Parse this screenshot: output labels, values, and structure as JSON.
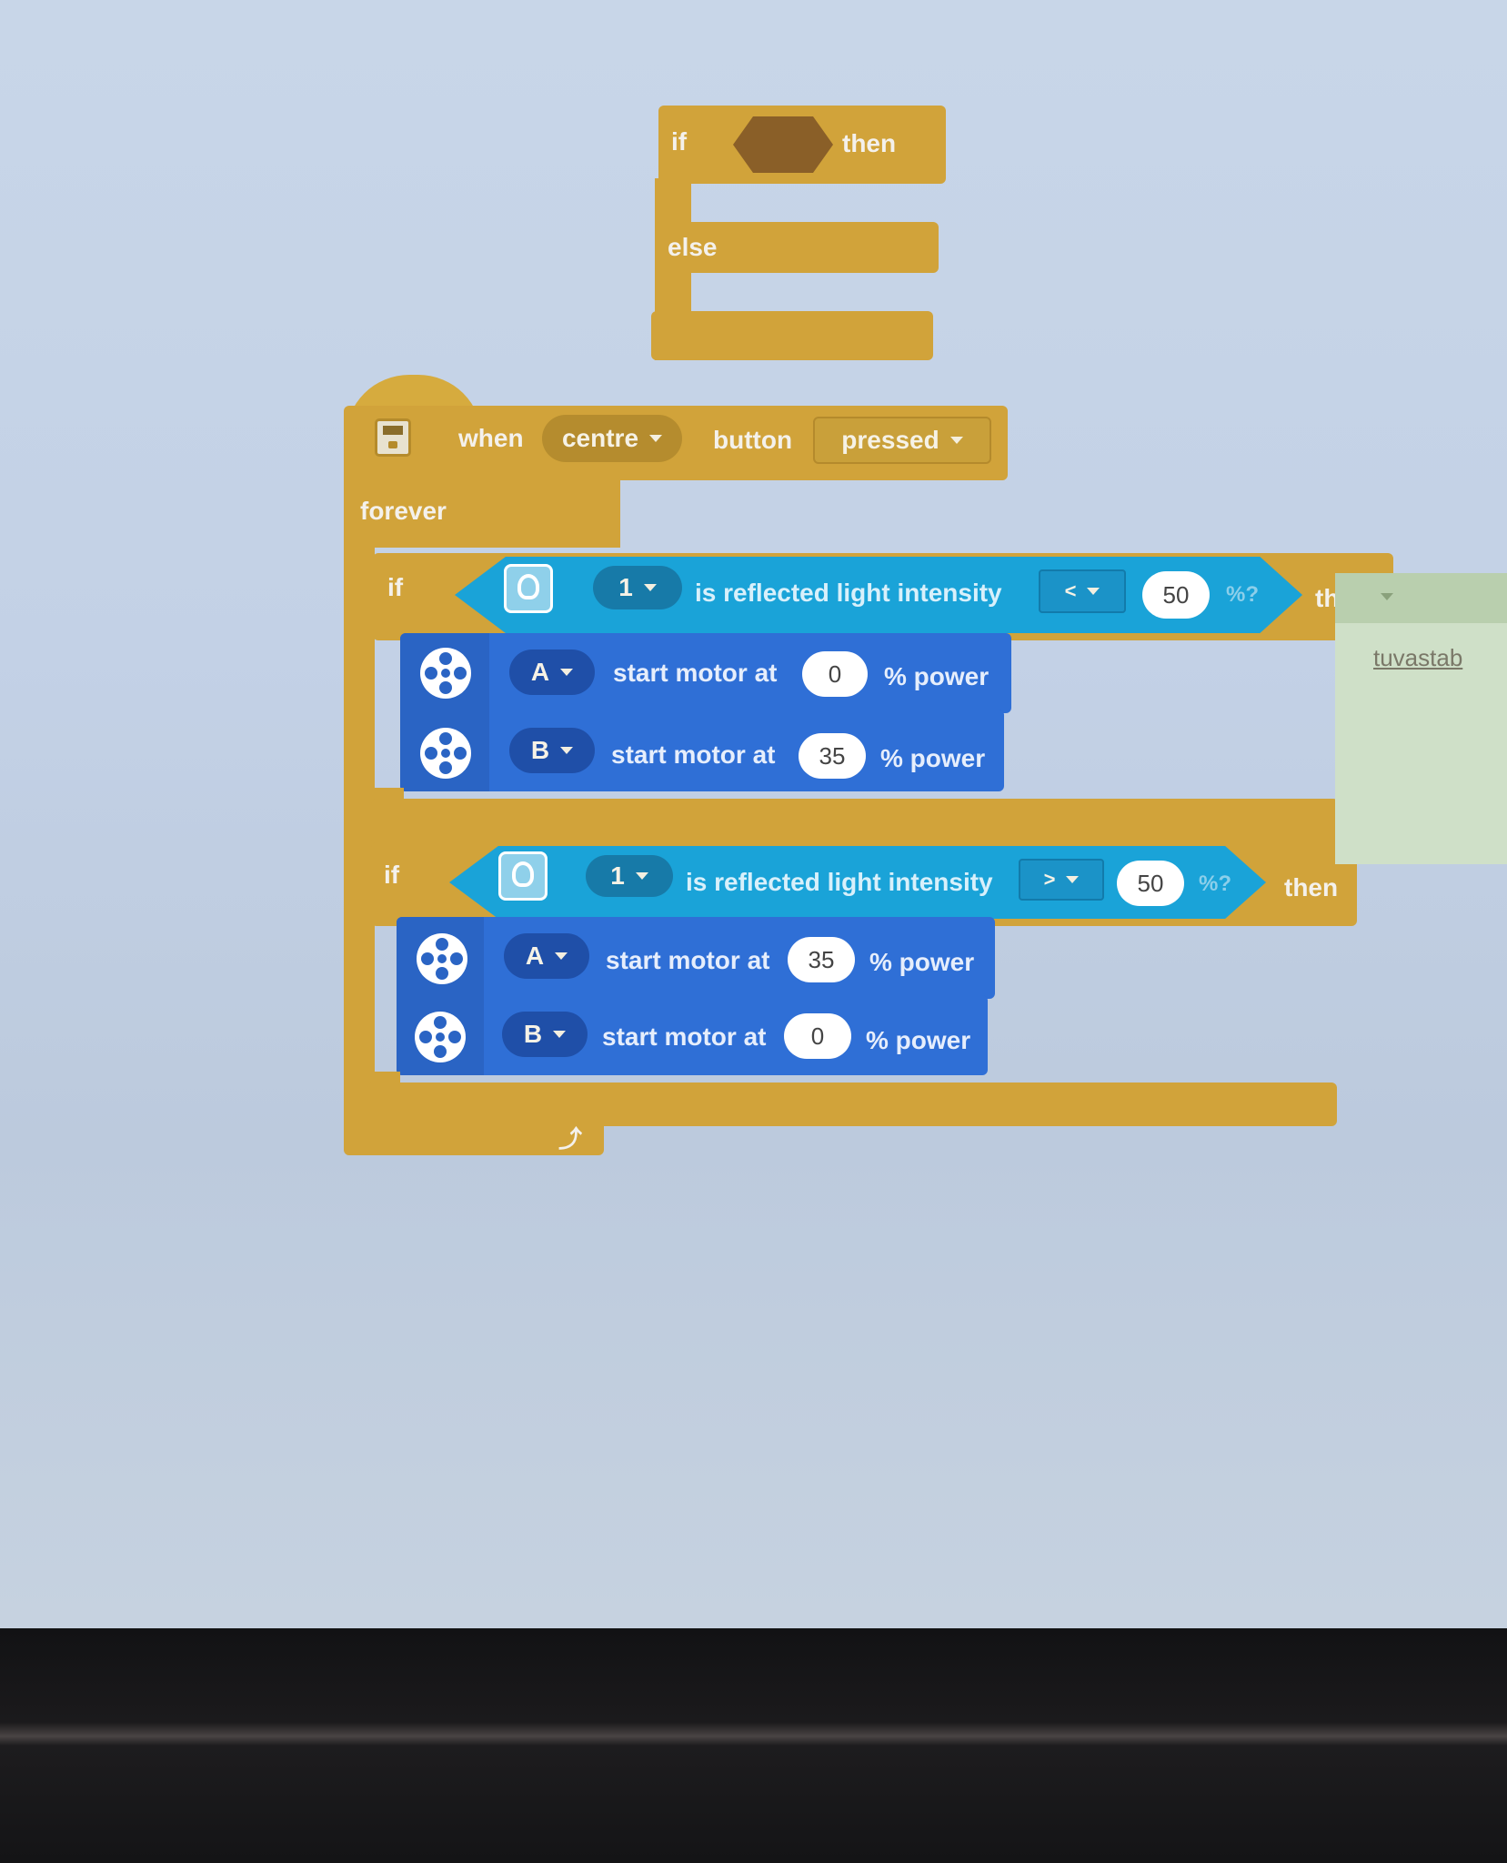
{
  "top_if_block": {
    "if_label": "if",
    "then_label": "then",
    "else_label": "else"
  },
  "hat_block": {
    "when_label": "when",
    "button_dropdown": "centre",
    "button_label": "button",
    "state_dropdown": "pressed"
  },
  "forever_label": "forever",
  "if1": {
    "if_label": "if",
    "port": "1",
    "condition_text": "is reflected light intensity",
    "operator": "<",
    "value": "50",
    "unit": "%?",
    "then_label": "the",
    "motors": [
      {
        "port": "A",
        "text": "start motor at",
        "value": "0",
        "unit": "% power"
      },
      {
        "port": "B",
        "text": "start motor at",
        "value": "35",
        "unit": "% power"
      }
    ]
  },
  "if2": {
    "if_label": "if",
    "port": "1",
    "condition_text": "is reflected light intensity",
    "operator": ">",
    "value": "50",
    "unit": "%?",
    "then_label": "then",
    "motors": [
      {
        "port": "A",
        "text": "start motor at",
        "value": "35",
        "unit": "% power"
      },
      {
        "port": "B",
        "text": "start motor at",
        "value": "0",
        "unit": "% power"
      }
    ]
  },
  "side_note": {
    "text": "tuvastab"
  },
  "colors": {
    "control": "#d1a33a",
    "sensor": "#1aa3d8",
    "motor": "#2f6fd6"
  }
}
